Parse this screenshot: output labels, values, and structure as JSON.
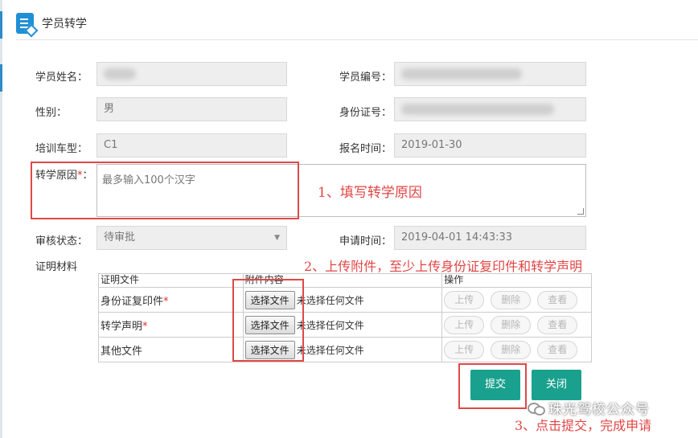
{
  "header": {
    "title": "学员转学",
    "icon": "form-document-icon"
  },
  "form": {
    "name_label": "学员姓名：",
    "id_label": "学员编号：",
    "gender_label": "性别：",
    "gender_value": "男",
    "idcard_label": "身份证号：",
    "vehicle_label": "培训车型：",
    "vehicle_value": "C1",
    "signup_label": "报名时间：",
    "signup_value": "2019-01-30",
    "reason_label": "转学原因",
    "reason_placeholder": "最多输入100个汉字",
    "required_mark": "*",
    "reason_colon": "：",
    "status_label": "审核状态：",
    "status_value": "待审批",
    "apply_label": "申请时间：",
    "apply_value": "2019-04-01 14:43:33",
    "materials_label": "证明材料"
  },
  "files": {
    "headers": [
      "证明文件",
      "附件内容",
      "操作"
    ],
    "choose_label": "选择文件",
    "no_file_text": "未选择任何文件",
    "actions": [
      "上传",
      "删除",
      "查看"
    ],
    "rows": [
      {
        "name": "身份证复印件",
        "required": true
      },
      {
        "name": "转学声明",
        "required": true
      },
      {
        "name": "其他文件",
        "required": false
      }
    ]
  },
  "buttons": {
    "submit": "提交",
    "close": "关闭"
  },
  "annotations": {
    "step1": "1、填写转学原因",
    "step2": "2、上传附件，至少上传身份证复印件和转学声明",
    "step3": "3、点击提交，完成申请"
  },
  "watermark": "珠光驾校公众号",
  "colors": {
    "accent": "#1aa18e",
    "annotation": "#e24545",
    "header_icon": "#1f8fd6"
  }
}
